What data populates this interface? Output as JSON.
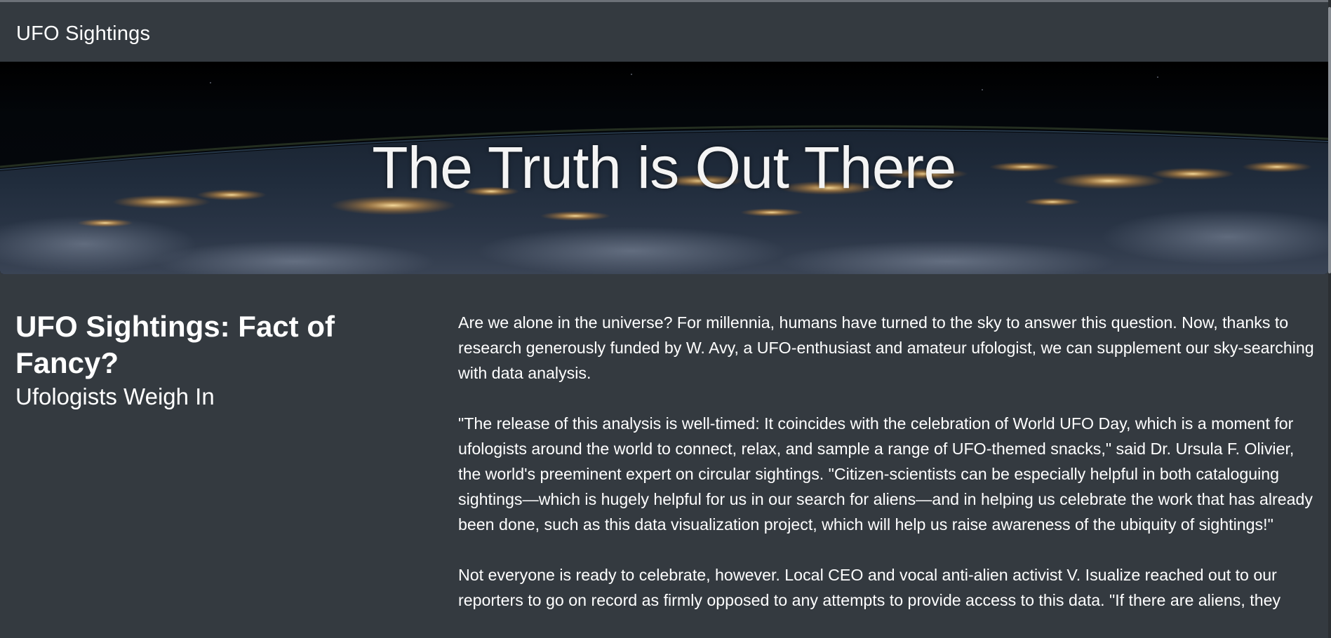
{
  "navbar": {
    "brand": "UFO Sightings"
  },
  "hero": {
    "title": "The Truth is Out There"
  },
  "article": {
    "headline": "UFO Sightings: Fact of Fancy?",
    "subheadline": "Ufologists Weigh In",
    "paragraphs": [
      "Are we alone in the universe? For millennia, humans have turned to the sky to answer this question. Now, thanks to research generously funded by W. Avy, a UFO-enthusiast and amateur ufologist, we can supplement our sky-searching with data analysis.",
      "\"The release of this analysis is well-timed: It coincides with the celebration of World UFO Day, which is a moment for ufologists around the world to connect, relax, and sample a range of UFO-themed snacks,\" said Dr. Ursula F. Olivier, the world's preeminent expert on circular sightings. \"Citizen-scientists can be especially helpful in both cataloguing sightings—which is hugely helpful for us in our search for aliens—and in helping us celebrate the work that has already been done, such as this data visualization project, which will help us raise awareness of the ubiquity of sightings!\"",
      "Not everyone is ready to celebrate, however. Local CEO and vocal anti-alien activist V. Isualize reached out to our reporters to go on record as firmly opposed to any attempts to provide access to this data. \"If there are aliens, they"
    ]
  },
  "colors": {
    "page_background": "#343a40",
    "text": "#ffffff"
  }
}
